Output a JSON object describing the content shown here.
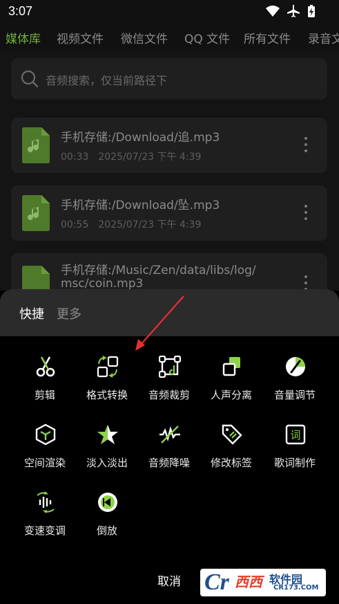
{
  "status_bar": {
    "time": "3:07",
    "icons": [
      "wifi-icon",
      "airplane-icon",
      "battery-charging-icon"
    ]
  },
  "tabs": [
    "媒体库",
    "视频文件",
    "微信文件",
    "QQ 文件",
    "所有文件",
    "录音文"
  ],
  "active_tab": 0,
  "search": {
    "placeholder": "音频搜索，仅当前路径下"
  },
  "files": [
    {
      "name": "手机存储:/Download/追.mp3",
      "duration": "00:33",
      "date": "2025/07/23 下午 4:39"
    },
    {
      "name": "手机存储:/Download/坠.mp3",
      "duration": "00:55",
      "date": "2025/07/23 下午 4:39"
    },
    {
      "name_line1": "手机存储:/Music/Zen/data/libs/log/",
      "name_line2": "msc/coin.mp3"
    }
  ],
  "sheet": {
    "tab_quick": "快捷",
    "tab_more": "更多",
    "tools": [
      {
        "label": "剪辑",
        "icon": "scissors-icon"
      },
      {
        "label": "格式转换",
        "icon": "format-convert-icon"
      },
      {
        "label": "音频裁剪",
        "icon": "crop-icon"
      },
      {
        "label": "人声分离",
        "icon": "separate-icon"
      },
      {
        "label": "音量调节",
        "icon": "volume-dial-icon"
      },
      {
        "label": "空间渲染",
        "icon": "cube-icon"
      },
      {
        "label": "淡入淡出",
        "icon": "star-icon"
      },
      {
        "label": "音频降噪",
        "icon": "denoise-icon"
      },
      {
        "label": "修改标签",
        "icon": "tag-icon"
      },
      {
        "label": "歌词制作",
        "icon": "lyrics-icon"
      },
      {
        "label": "变速变调",
        "icon": "speed-pitch-icon"
      },
      {
        "label": "倒放",
        "icon": "reverse-icon"
      }
    ],
    "cancel": "取消"
  },
  "watermark": {
    "logo": "Cr",
    "brand": "西西",
    "site": "软件园",
    "url": "CR173.COM"
  },
  "colors": {
    "accent": "#6fae3a",
    "sheet_header": "#2b2b2b",
    "card": "#1f1f1f",
    "arrow": "#e53030"
  }
}
